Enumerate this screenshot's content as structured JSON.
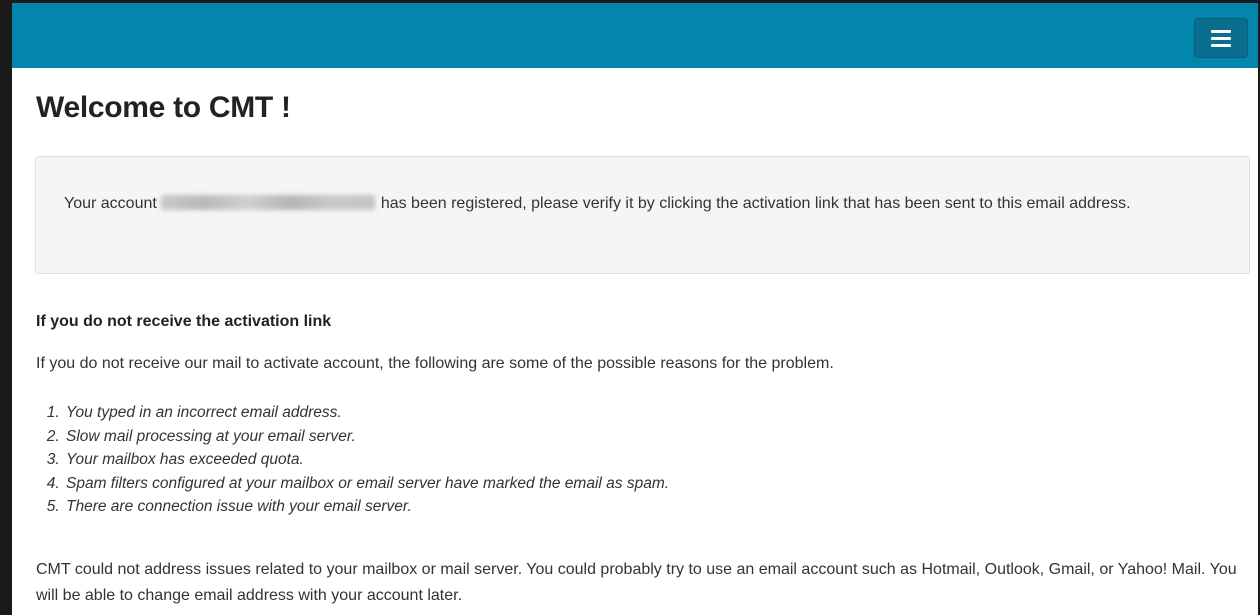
{
  "page": {
    "title": "Welcome to CMT !"
  },
  "navbar": {
    "menu_icon": "hamburger-menu-icon",
    "background_color": "#0286ac"
  },
  "notice": {
    "text_before": "Your account",
    "email_redacted": true,
    "text_after": "has been registered, please verify it by clicking the activation link that has been sent to this email address."
  },
  "help": {
    "heading": "If you do not receive the activation link",
    "intro": "If you do not receive our mail to activate account, the following are some of the possible reasons for the problem.",
    "reasons": [
      "You typed in an incorrect email address.",
      "Slow mail processing at your email server.",
      "Your mailbox has exceeded quota.",
      "Spam filters configured at your mailbox or email server have marked the email as spam.",
      "There are connection issue with your email server."
    ],
    "footer": "CMT could not address issues related to your mailbox or mail server. You could probably try to use an email account such as Hotmail, Outlook, Gmail, or Yahoo! Mail. You will be able to change email address with your account later."
  }
}
